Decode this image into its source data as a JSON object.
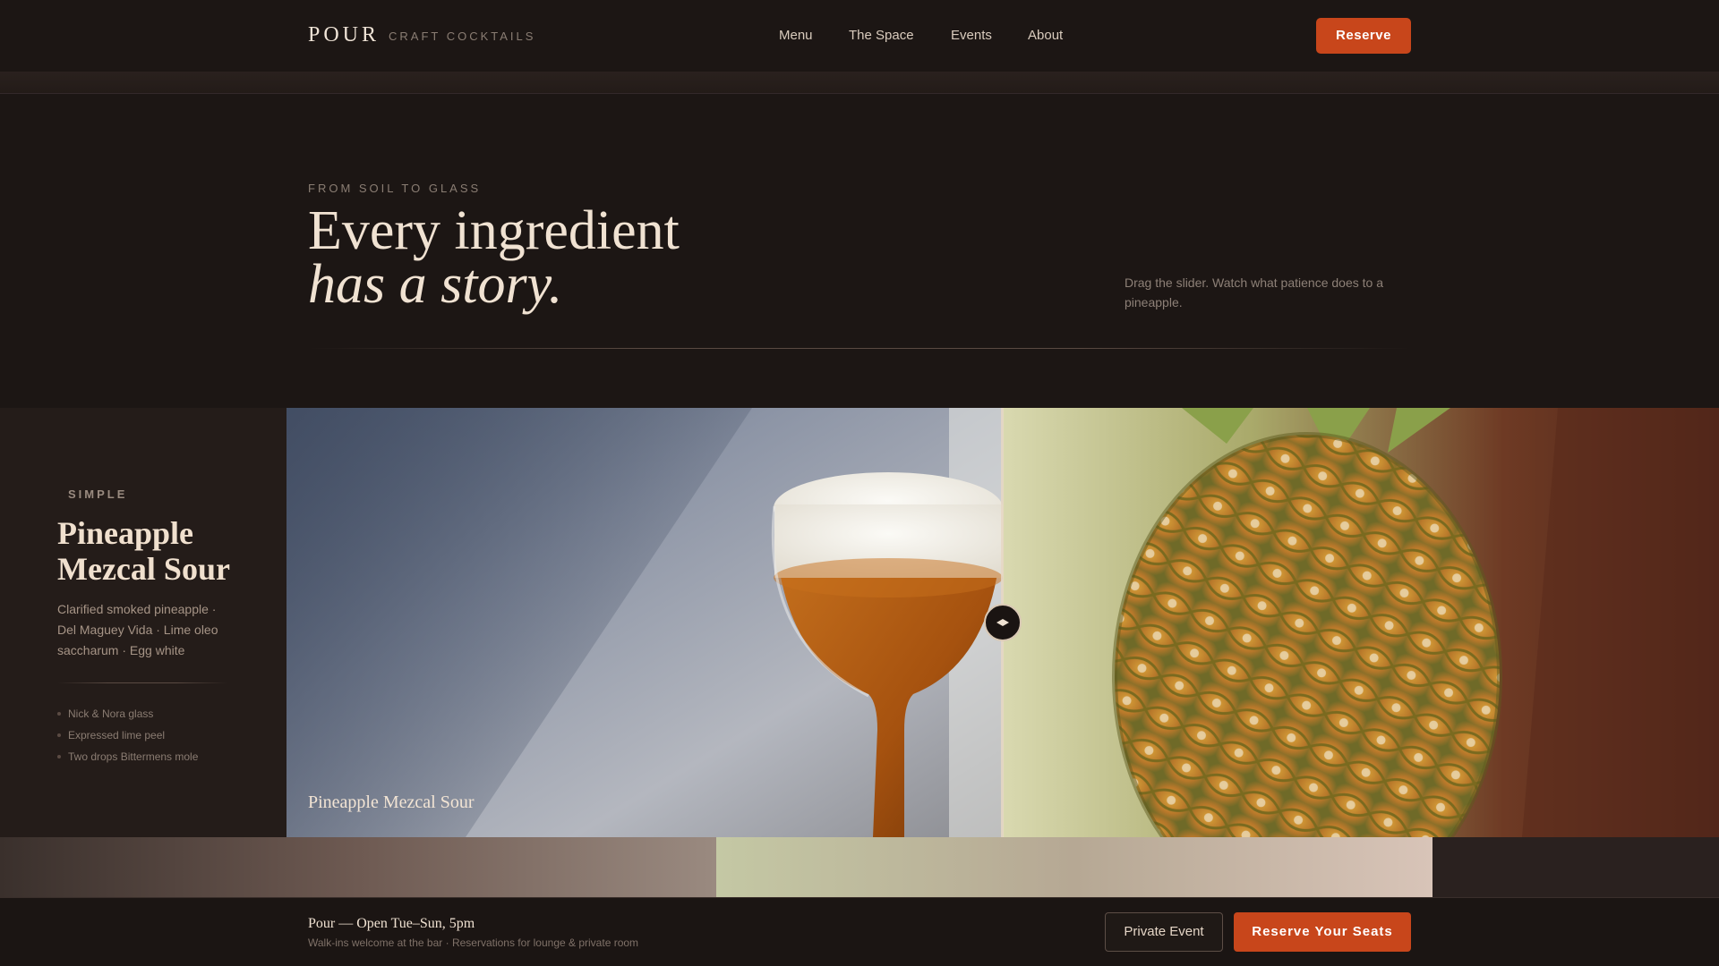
{
  "nav": {
    "brand": "POUR",
    "brand_sub": "CRAFT COCKTAILS",
    "links": [
      "Menu",
      "The Space",
      "Events",
      "About"
    ],
    "reserve_label": "Reserve"
  },
  "hero": {
    "eyebrow": "FROM SOIL TO GLASS",
    "title_line1": "Every ingredient",
    "title_line2": "has a story.",
    "hint": "Drag the slider. Watch what patience does to a pineapple."
  },
  "feature": {
    "tag": "SIMPLE",
    "name": "Pineapple Mezcal Sour",
    "description": "Clarified smoked pineapple · Del Maguey Vida · Lime oleo saccharum · Egg white",
    "notes": [
      "Nick & Nora glass",
      "Expressed lime peel",
      "Two drops Bittermens mole"
    ],
    "slider_caption": "Pineapple Mezcal Sour",
    "slider_position_percent": 50,
    "images": [
      "cocktail-coupe-photo",
      "pineapple-photo"
    ]
  },
  "footer": {
    "title": "Pour — Open Tue–Sun, 5pm",
    "subtitle": "Walk-ins welcome at the bar · Reservations for lounge & private room",
    "private_label": "Private Event",
    "reserve_label": "Reserve Your Seats"
  },
  "colors": {
    "background": "#1c1614",
    "accent": "#c8461b",
    "text": "#f0e2d2",
    "muted": "#8a7d73"
  }
}
